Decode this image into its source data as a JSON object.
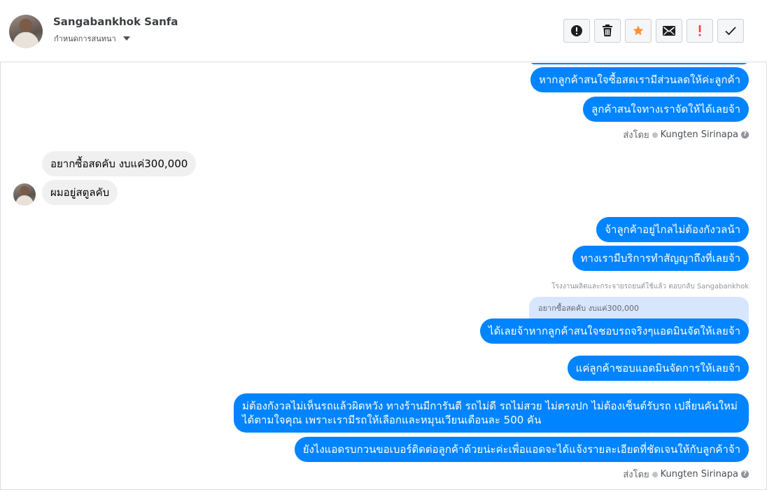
{
  "header": {
    "contact_name": "Sangabankhok Sanfa",
    "assign_label": "กำหนดการสนทนา"
  },
  "toolbar": {
    "buttons": [
      {
        "name": "report",
        "icon": "alert-circle-icon",
        "label": "!"
      },
      {
        "name": "delete",
        "icon": "trash-icon"
      },
      {
        "name": "star",
        "icon": "star-icon",
        "color": "#f7923a"
      },
      {
        "name": "mark-unread",
        "icon": "envelope-icon"
      },
      {
        "name": "follow-up",
        "icon": "exclamation-icon",
        "color": "#fa3e3e"
      },
      {
        "name": "done",
        "icon": "check-icon"
      }
    ]
  },
  "messages": {
    "out_1": "หากลูกค้าสนใจซื้อสดเรามีส่วนลดให้ค่ะลูกค้า",
    "out_2": "ลูกค้าสนใจทางเราจัดให้ได้เลยจ้า",
    "in_1": "อยากซื้อสดคับ งบแค่300,000",
    "in_2": "ผมอยู่สตูลคับ",
    "out_3": "จ้าลูกค้าอยู่ไกลไม่ต้องกังวลน้า",
    "out_4": "ทางเรามีบริการทำสัญญาถึงที่เลยจ้า",
    "reply_note": "โรงงานผลิตและกระจายรถยนต์ใช้แล้ว ตอบกลับ Sangabankhok",
    "quoted_text": "อยากซื้อสดคับ งบแค่300,000",
    "out_5": "ได้เลยจ้าหากลูกค้าสนใจชอบรถจริงๆแอดมินจัดให้เลยจ้า",
    "out_6": "แค่ลูกค้าชอบแอดมินจัดการให้เลยจ้า",
    "out_7": "ม่ต้องกังวลไม่เห็นรถแล้วผิดหวัง ทางร้านมีการันตี รถไม่ดี รถไม่สวย ไม่ตรงปก ไม่ต้องเซ็นต์รับรถ เปลี่ยนคันใหม่ได้ตามใจคุณ เพราะเรามีรถให้เลือกและหมุนเวียนเดือนละ 500 คัน",
    "out_8": "ยังไงแอดรบกวนขอเบอร์ติดต่อลูกค้าด้วยน่ะค่ะเพื่อแอดจะได้แจ้งรายละเอียดที่ชัดเจนให้กับลูกค้าจ้า"
  },
  "meta": {
    "sent_by_label": "ส่งโดย",
    "sender_name": "Kungten Sirinapa",
    "help": "?"
  }
}
